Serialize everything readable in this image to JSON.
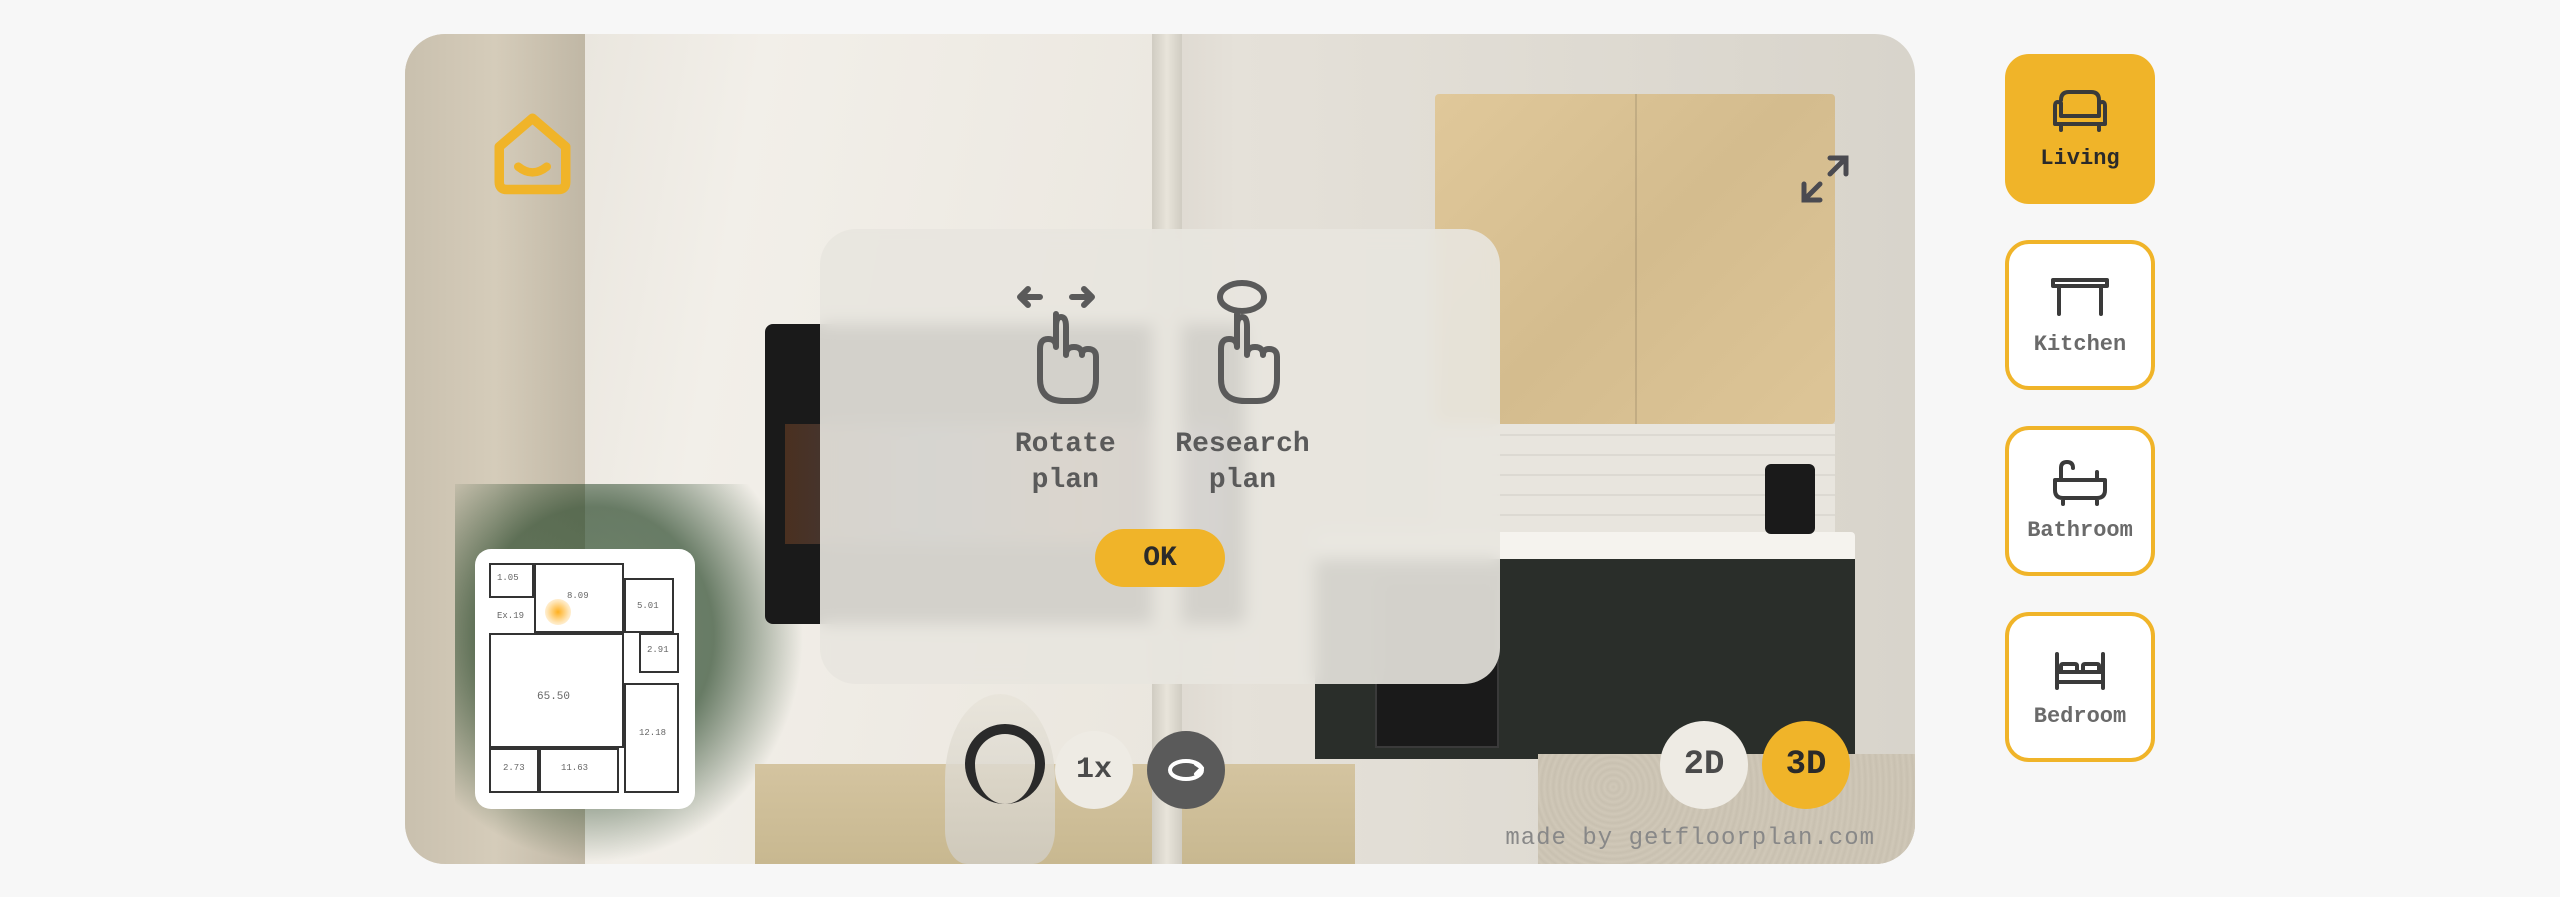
{
  "colors": {
    "accent": "#f0b429",
    "ink": "#3a3a3a",
    "muted": "#6a6a6a"
  },
  "tutorial": {
    "rotate_label": "Rotate\nplan",
    "research_label": "Research\nplan",
    "ok_label": "OK"
  },
  "controls": {
    "speed_label": "1x",
    "view_2d_label": "2D",
    "view_3d_label": "3D"
  },
  "rooms": {
    "living": "Living",
    "kitchen": "Kitchen",
    "bathroom": "Bathroom",
    "bedroom": "Bedroom"
  },
  "minimap": {
    "labels": [
      "1.05",
      "8.09",
      "5.01",
      "2.91",
      "65.50",
      "11.63",
      "2.73",
      "12.18",
      "Ex.19"
    ],
    "current_room": "living"
  },
  "watermark": "made by getfloorplan.com"
}
